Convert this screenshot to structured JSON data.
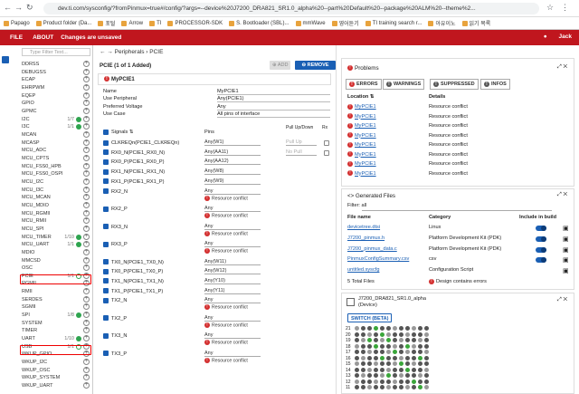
{
  "browser": {
    "url": "dev.ti.com/sysconfig/?fromPinmux=true#/config/?args=--device%20J7200_DRA821_SR1.0_alpha%20--part%20Default%20--package%20ALM%20--theme%2...",
    "bookmarks": [
      "Papago",
      "Product folder (Da...",
      "포털",
      "Arrow",
      "TI",
      "PROCESSOR-SDK",
      "S. Bootloader (SBL)...",
      "mmWave",
      "영어듣기",
      "TI training search r...",
      "아유이노",
      "읽기 목록"
    ]
  },
  "app": {
    "file": "FILE",
    "about": "ABOUT",
    "unsaved": "Changes are unsaved",
    "user": "Jack"
  },
  "left": {
    "filter_placeholder": "Type Filter Text...",
    "items": [
      {
        "name": "DDRSS"
      },
      {
        "name": "DEBUGSS"
      },
      {
        "name": "ECAP"
      },
      {
        "name": "EHRPWM"
      },
      {
        "name": "EQEP"
      },
      {
        "name": "GPIO"
      },
      {
        "name": "GPMC"
      },
      {
        "name": "I2C",
        "count": "1/7",
        "ok": true
      },
      {
        "name": "I3C",
        "count": "1/1",
        "ok": true
      },
      {
        "name": "MCAN"
      },
      {
        "name": "MCASP"
      },
      {
        "name": "MCU_ADC"
      },
      {
        "name": "MCU_CPTS"
      },
      {
        "name": "MCU_FSS0_HPB"
      },
      {
        "name": "MCU_FSS0_OSPI"
      },
      {
        "name": "MCU_I2C"
      },
      {
        "name": "MCU_I3C"
      },
      {
        "name": "MCU_MCAN"
      },
      {
        "name": "MCU_MDIO"
      },
      {
        "name": "MCU_RGMII"
      },
      {
        "name": "MCU_RMII"
      },
      {
        "name": "MCU_SPI"
      },
      {
        "name": "MCU_TIMER",
        "count": "1/10",
        "ok": true
      },
      {
        "name": "MCU_UART",
        "count": "1/1",
        "ok": true
      },
      {
        "name": "MDIO"
      },
      {
        "name": "MMCSD"
      },
      {
        "name": "OSC"
      },
      {
        "name": "PCIE",
        "count": "1/1",
        "ok": false
      },
      {
        "name": "RGMII"
      },
      {
        "name": "RMII"
      },
      {
        "name": "SERDES"
      },
      {
        "name": "SGMII"
      },
      {
        "name": "SPI",
        "count": "1/8",
        "ok": true
      },
      {
        "name": "SYSTEM"
      },
      {
        "name": "TIMER"
      },
      {
        "name": "UART",
        "count": "1/10",
        "ok": true
      },
      {
        "name": "USB",
        "count": "1/1",
        "ok": false
      },
      {
        "name": "WKUP_GPIO"
      },
      {
        "name": "WKUP_I2C"
      },
      {
        "name": "WKUP_OSC"
      },
      {
        "name": "WKUP_SYSTEM"
      },
      {
        "name": "WKUP_UART"
      }
    ]
  },
  "mid": {
    "breadcrumb": "Peripherals › PCIE",
    "header": "PCIE (1 of 1 Added)",
    "add": "ADD",
    "remove_all": "REMOVE ALL",
    "instance": "MyPCIE1",
    "props": [
      {
        "k": "Name",
        "v": "MyPCIE1"
      },
      {
        "k": "Use Peripheral",
        "v": "Any(PCIE1)"
      },
      {
        "k": "Preferred Voltage",
        "v": "Any"
      },
      {
        "k": "Use Case",
        "v": "All pins of interface"
      }
    ],
    "cols": {
      "signals": "Signals",
      "pins": "Pins",
      "pull": "Pull Up/Down",
      "rx": "Rx"
    },
    "signals": [
      {
        "n": "CLKREQn(PCIE1_CLKREQn)",
        "p": "Any(W1)",
        "pull": "Pull Up",
        "conflict": false
      },
      {
        "n": "RX0_N(PCIE1_RX0_N)",
        "p": "Any(AA11)",
        "pull": "No Pull",
        "conflict": false
      },
      {
        "n": "RX0_P(PCIE1_RX0_P)",
        "p": "Any(AA12)",
        "conflict": false
      },
      {
        "n": "RX1_N(PCIE1_RX1_N)",
        "p": "Any(W8)",
        "conflict": false
      },
      {
        "n": "RX1_P(PCIE1_RX1_P)",
        "p": "Any(W9)",
        "conflict": false
      },
      {
        "n": "RX2_N",
        "p": "Any",
        "conflict": true
      },
      {
        "n": "RX2_P",
        "p": "Any",
        "conflict": true
      },
      {
        "n": "RX3_N",
        "p": "Any",
        "conflict": true
      },
      {
        "n": "RX3_P",
        "p": "Any",
        "conflict": true
      },
      {
        "n": "TX0_N(PCIE1_TX0_N)",
        "p": "Any(W11)",
        "conflict": false
      },
      {
        "n": "TX0_P(PCIE1_TX0_P)",
        "p": "Any(W12)",
        "conflict": false
      },
      {
        "n": "TX1_N(PCIE1_TX1_N)",
        "p": "Any(Y10)",
        "conflict": false
      },
      {
        "n": "TX1_P(PCIE1_TX1_P)",
        "p": "Any(Y11)",
        "conflict": false
      },
      {
        "n": "TX2_N",
        "p": "Any",
        "conflict": true
      },
      {
        "n": "TX2_P",
        "p": "Any",
        "conflict": true
      },
      {
        "n": "TX3_N",
        "p": "Any",
        "conflict": true
      },
      {
        "n": "TX3_P",
        "p": "Any",
        "conflict": true
      }
    ],
    "conflict_text": "Resource conflict"
  },
  "problems": {
    "title": "Problems",
    "tabs": [
      "ERRORS",
      "WARNINGS",
      "SUPPRESSED",
      "INFOS"
    ],
    "col_loc": "Location",
    "col_det": "Details",
    "rows": [
      "MyPCIE1",
      "MyPCIE1",
      "MyPCIE1",
      "MyPCIE1",
      "MyPCIE1",
      "MyPCIE1",
      "MyPCIE1",
      "MyPCIE1"
    ],
    "detail": "Resource conflict"
  },
  "files": {
    "title": "Generated Files",
    "filter": "Filter:",
    "filter_val": "all",
    "cols": [
      "File name",
      "Category",
      "Include in build"
    ],
    "rows": [
      {
        "f": "devicetree.dtsi",
        "c": "Linux",
        "t": true
      },
      {
        "f": "J7200_pinmux.h",
        "c": "Platform Development Kit (PDK)",
        "t": true
      },
      {
        "f": "J7200_pinmux_data.c",
        "c": "Platform Development Kit (PDK)",
        "t": true
      },
      {
        "f": "PinmuxConfigSummary.csv",
        "c": "csv",
        "t": true
      },
      {
        "f": "untitled.syscfg",
        "c": "Configuration Script",
        "t": false
      }
    ],
    "total": "5 Total Files",
    "err": "Design contains errors"
  },
  "device": {
    "name": "J7200_DRA821_SR1.0_alpha",
    "sub": "(Device)",
    "switch": "SWITCH (BETA)",
    "rows": [
      "21",
      "20",
      "19",
      "18",
      "17",
      "16",
      "15",
      "14",
      "13",
      "12",
      "11"
    ]
  }
}
